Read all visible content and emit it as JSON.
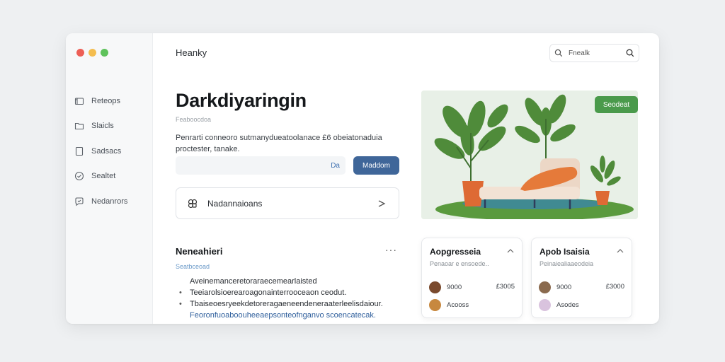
{
  "window": {
    "title": "Heanky",
    "traffic_colors": [
      "#ed5f56",
      "#f4bd4f",
      "#5ec25b"
    ]
  },
  "search": {
    "value": "Fnealk",
    "placeholder": "Fnealk"
  },
  "sidebar": {
    "items": [
      {
        "label": "Reteops",
        "icon": "folder-icon"
      },
      {
        "label": "Slaicls",
        "icon": "file-icon"
      },
      {
        "label": "Sadsacs",
        "icon": "document-icon"
      },
      {
        "label": "Sealtet",
        "icon": "check-circle-icon"
      },
      {
        "label": "Nedanrors",
        "icon": "chat-icon"
      }
    ]
  },
  "hero": {
    "title": "Darkdiyaringin",
    "subtitle": "Feaboocdoa",
    "description": "Penrarti conneoro sutmanydueatoolanace £6 obeiatonaduia proctester, tanake.",
    "input_suffix": "Da",
    "button_label": "Maddom"
  },
  "card": {
    "label": "Nadannaioans"
  },
  "section": {
    "title": "Neneahieri",
    "more": "···",
    "subtitle": "Seatbceoad",
    "lines": [
      {
        "text": "Aveinemanceretoraraecemearlaisted",
        "style": "indent"
      },
      {
        "text": "Teeiarolsioerearoagonainterrooceaon ceodut.",
        "style": "bullet"
      },
      {
        "text": "Tbaiseoesryeekdetoreragaeneendeneraaterleelisdaiour.",
        "style": "bullet"
      },
      {
        "text": "Feoronfuoaboouheeaepsonteofnganvo scoencatecak.",
        "style": "link"
      }
    ]
  },
  "illustration": {
    "badge": "Seodeat"
  },
  "mini_cards": [
    {
      "title": "Aopgresseia",
      "subtitle": "Penaoar e ensoede..",
      "rows": [
        {
          "label": "9000",
          "value": "£3005",
          "avatar_color": "#7a4a2e"
        },
        {
          "label": "Acooss",
          "value": "",
          "avatar_color": "#c7883f"
        }
      ]
    },
    {
      "title": "Apob Isaisia",
      "subtitle": "Peinaiealiaaeodeia",
      "rows": [
        {
          "label": "9000",
          "value": "£3000",
          "avatar_color": "#8a6a4e"
        },
        {
          "label": "Asodes",
          "value": "",
          "avatar_color": "#d9c3de"
        }
      ]
    }
  ]
}
